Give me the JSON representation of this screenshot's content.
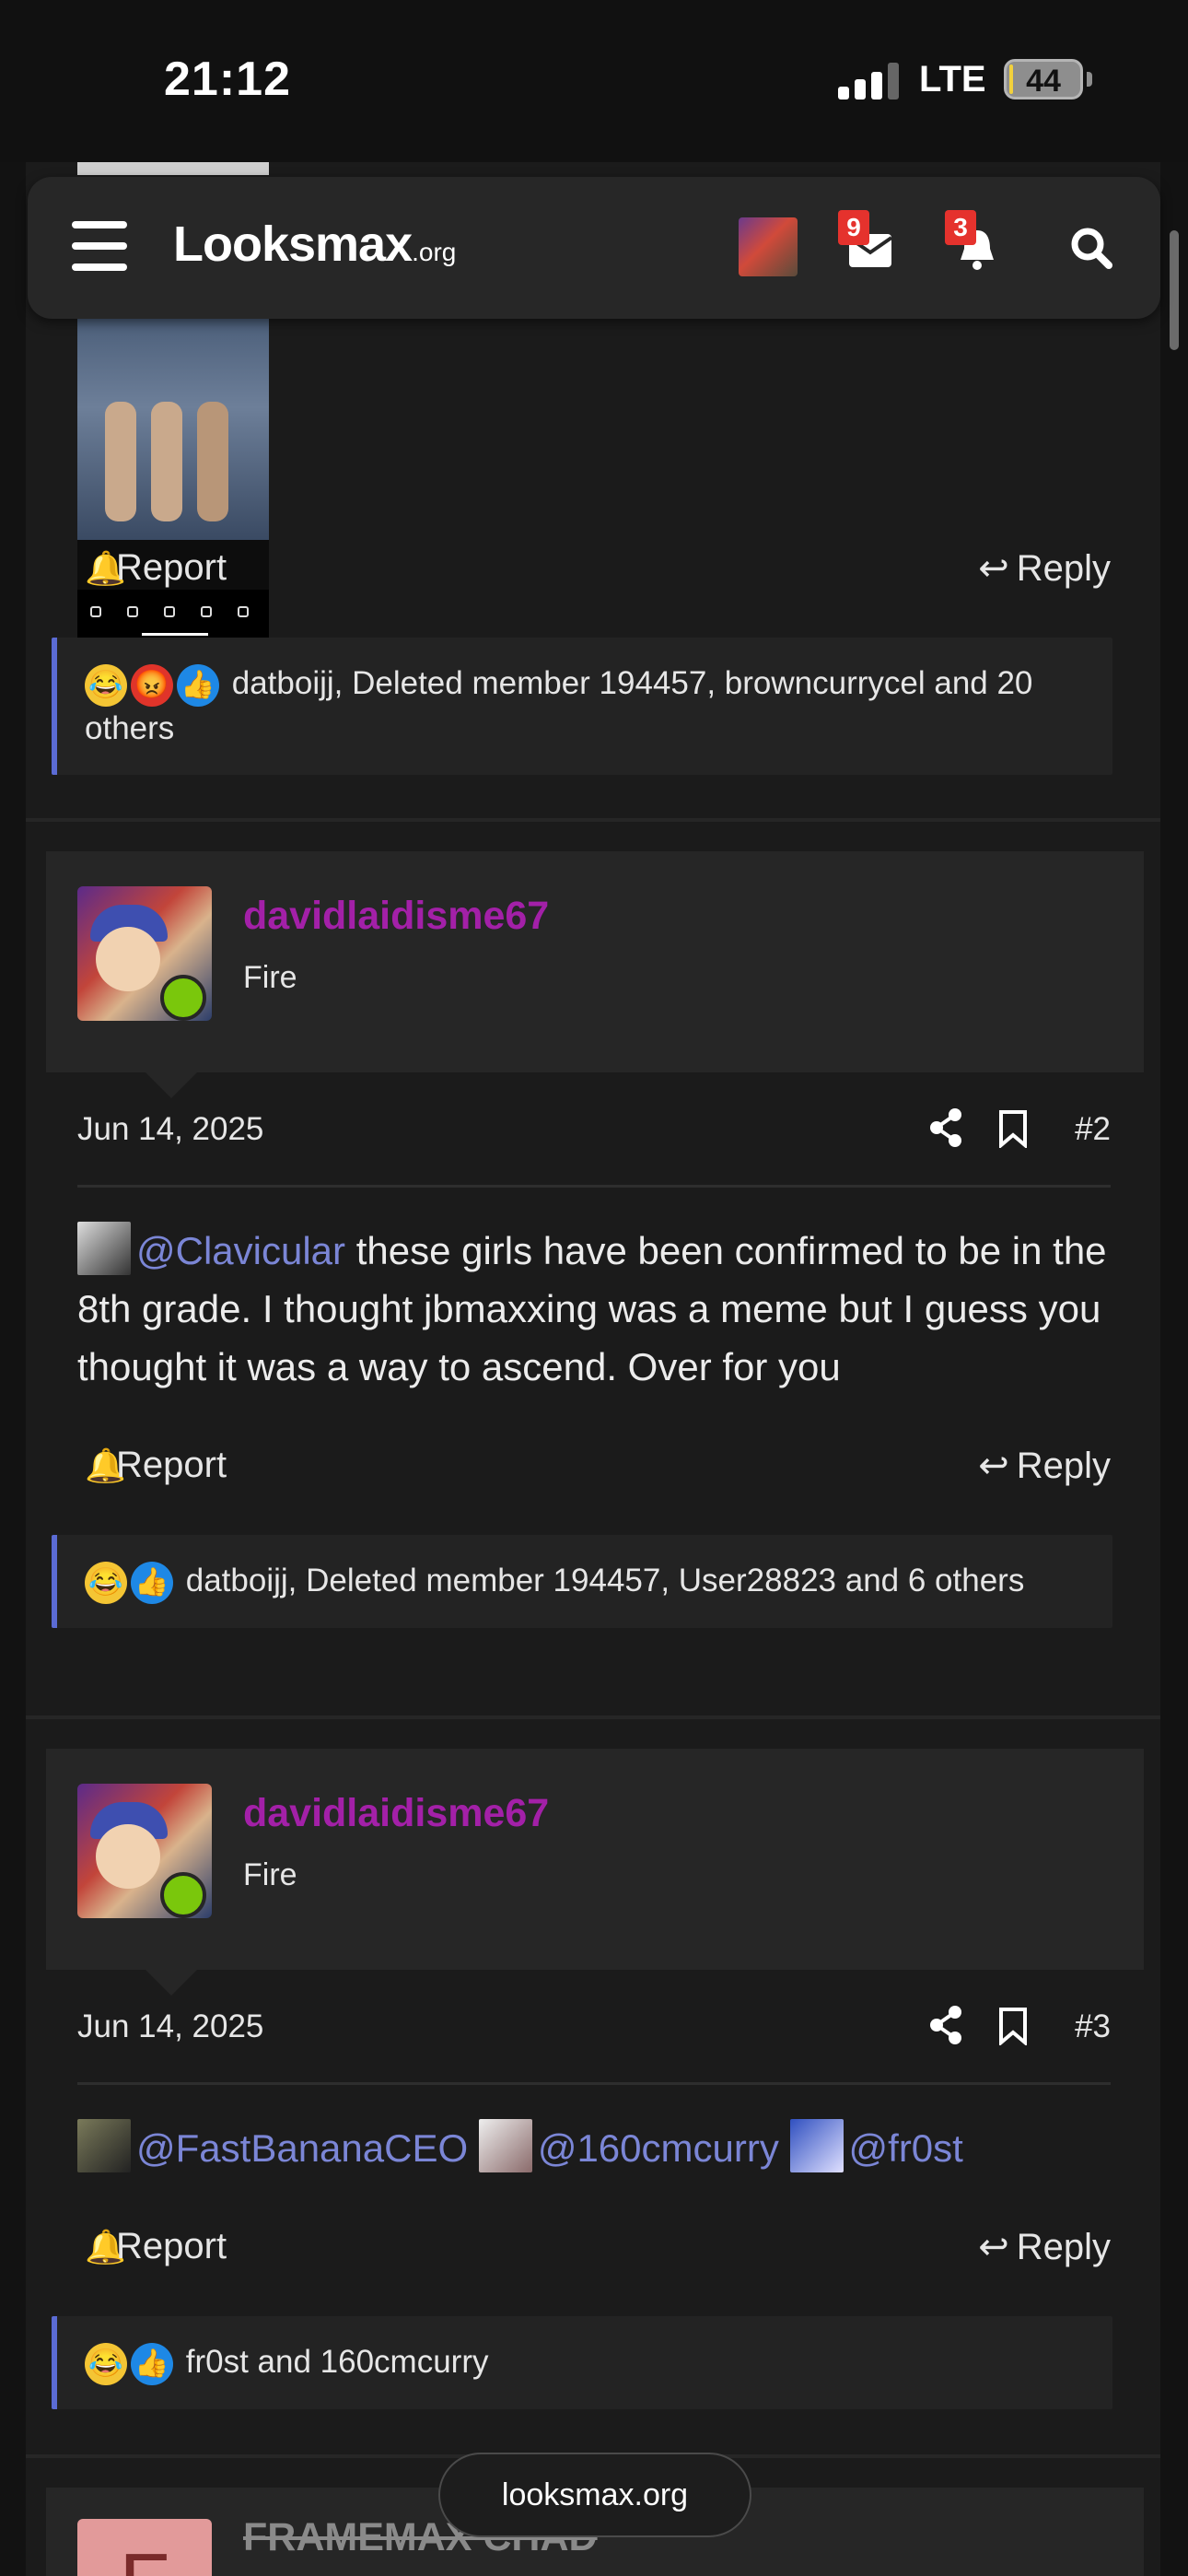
{
  "status_bar": {
    "time": "21:12",
    "network": "LTE",
    "battery": "44"
  },
  "navbar": {
    "logo": "Looksmax",
    "logo_suffix": ".org",
    "messages_badge": "9",
    "alerts_badge": "3"
  },
  "post1": {
    "report_label": "Report",
    "reply_label": "Reply",
    "reactions_text": "datboijj, Deleted member 194457, browncurrycel and 20 others"
  },
  "post2": {
    "username": "davidlaidisme67",
    "user_title": "Fire",
    "date": "Jun 14, 2025",
    "number": "#2",
    "mention": "@Clavicular",
    "body": " these girls have been confirmed to be in the 8th grade. I thought jbmaxxing was a meme but I guess you thought it was a way to ascend. Over for you",
    "report_label": "Report",
    "reply_label": "Reply",
    "reactions_text": "datboijj, Deleted member 194457, User28823 and 6 others"
  },
  "post3": {
    "username": "davidlaidisme67",
    "user_title": "Fire",
    "date": "Jun 14, 2025",
    "number": "#3",
    "mentions": [
      "@FastBananaCEO",
      "@160cmcurry",
      "@fr0st"
    ],
    "report_label": "Report",
    "reply_label": "Reply",
    "reactions_text": "fr0st and 160cmcurry"
  },
  "next_post": {
    "avatar_letter": "F",
    "username": "FRAMEMAX CHAD"
  },
  "floating_url": "looksmax.org",
  "colors": {
    "username": "#a320a8",
    "mention": "#7b86d6",
    "reaction_border": "#5b6bd4",
    "online": "#7ac70c",
    "badge": "#e5322d"
  }
}
